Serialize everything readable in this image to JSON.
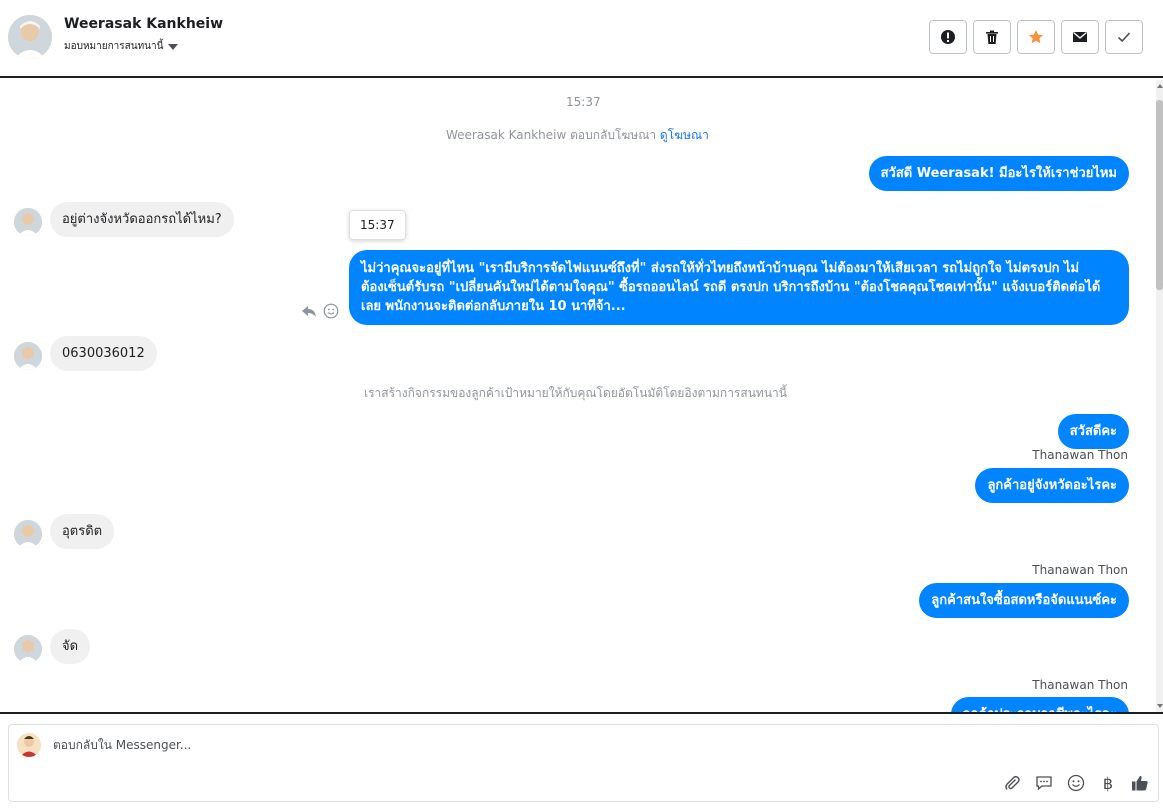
{
  "header": {
    "contact_name": "Weerasak Kankheiw",
    "assign_label": "มอบหมายการสนทนานี้",
    "actions": [
      {
        "name": "mark-spam-button",
        "icon": "exclamation-circle-icon"
      },
      {
        "name": "delete-button",
        "icon": "trash-icon"
      },
      {
        "name": "star-button",
        "icon": "star-icon",
        "color": "#f7923a"
      },
      {
        "name": "mark-unread-button",
        "icon": "envelope-icon"
      },
      {
        "name": "mark-done-button",
        "icon": "check-icon"
      }
    ]
  },
  "thread": {
    "timestamp_top": "15:37",
    "system_ad": "Weerasak Kankheiw ตอบกลับโฆษณา",
    "system_ad_link": "ดูโฆษณา",
    "msg1_out": "สวัสดี Weerasak! มีอะไรให้เราช่วยไหม",
    "msg2_in": "อยู่ต่างจังหวัดออกรถได้ไหม?",
    "tooltip_time": "15:37",
    "msg3_out_line1": "ไม่ว่าคุณจะอยู่ที่ไหน \"เรามีบริการจัดไฟแนนซ์ถึงที่\"  ส่งรถให้ทั่วไทยถึงหน้าบ้านคุณ ไม่ต้องมาให้เสียเวลา รถไม่ถูกใจ ไม่ตรงปก ไม่",
    "msg3_out_line2": "ต้องเซ็นต์รับรถ \"เปลี่ยนคันใหม่ได้ตามใจคุณ\" ซื้อรถออนไลน์ รถดี ตรงปก บริการถึงบ้าน \"ต้องโชคคุณโชคเท่านั้น\" แจ้งเบอร์ติดต่อได้",
    "msg3_out_line3": "เลย พนักงานจะติดต่อกลับภายใน 10 นาทีจ้า...",
    "msg4_in": "0630036012",
    "system_activity": "เราสร้างกิจกรรมของลูกค้าเป้าหมายให้กับคุณโดยอัตโนมัติโดยอิงตามการสนทนานี้",
    "msg5_out": "สวัสดีคะ",
    "sender_1": "Thanawan Thon",
    "msg6_out": "ลูกค้าอยู่จังหวัดอะไรคะ",
    "msg7_in": "อุตรดิต",
    "sender_2": "Thanawan Thon",
    "msg8_out": "ลูกค้าสนใจซื้อสดหรือจัดแนนซ์คะ",
    "msg9_in": "จัด",
    "sender_3": "Thanawan Thon",
    "msg10_out_partial": "ลูกค้าประกอบอาชีพอะไรคะ"
  },
  "composer": {
    "placeholder": "ตอบกลับใน Messenger...",
    "tools": [
      "attachment-icon",
      "saved-reply-icon",
      "emoji-icon",
      "baht-payment-icon",
      "thumbs-up-icon"
    ],
    "baht_symbol": "฿"
  },
  "colors": {
    "accent": "#0084ff",
    "incoming_bubble": "#f0f0f0",
    "star": "#f7923a"
  }
}
